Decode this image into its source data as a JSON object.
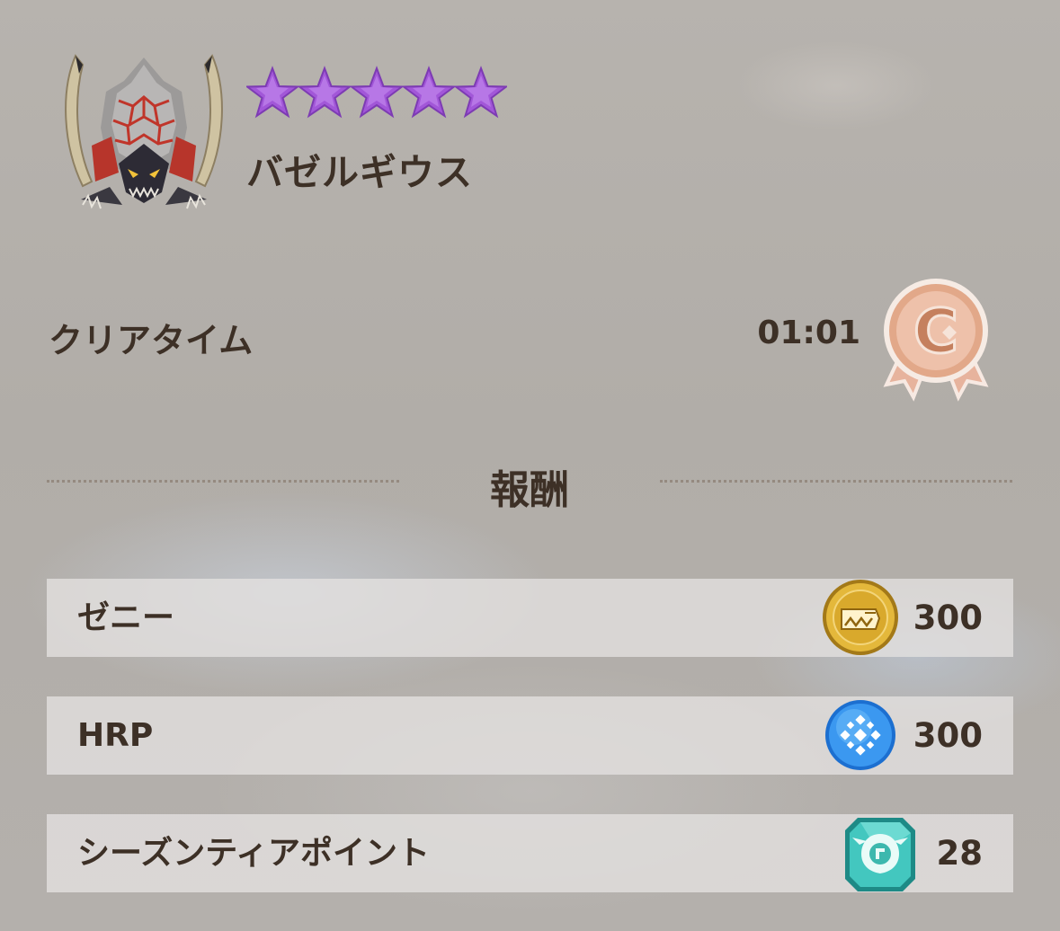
{
  "monster": {
    "name": "バゼルギウス",
    "star_rating": 5,
    "star_max": 5,
    "star_color": "#a257d8",
    "icon": "bazelgeuse-icon"
  },
  "clear_time": {
    "label": "クリアタイム",
    "value": "01:01",
    "rank": "C",
    "rank_icon": "rank-c-medal-icon",
    "rank_color": "#d9957a"
  },
  "rewards": {
    "title": "報酬",
    "items": [
      {
        "name": "ゼニー",
        "icon": "zenny-coin-icon",
        "amount": "300"
      },
      {
        "name": "HRP",
        "icon": "hrp-orb-icon",
        "amount": "300"
      },
      {
        "name": "シーズンティアポイント",
        "icon": "season-tier-point-icon",
        "amount": "28"
      }
    ]
  }
}
